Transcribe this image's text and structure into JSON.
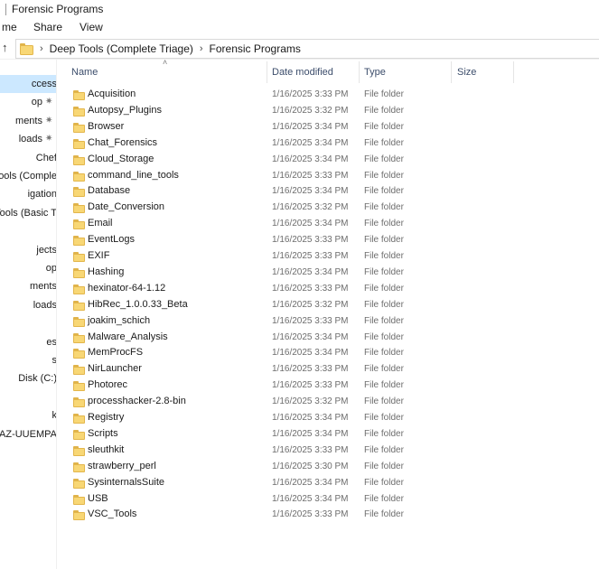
{
  "window": {
    "title": "Forensic Programs"
  },
  "ribbon": {
    "tabs": [
      "me",
      "Share",
      "View"
    ]
  },
  "address": {
    "crumbs": [
      "Deep Tools (Complete Triage)",
      "Forensic Programs"
    ]
  },
  "nav": {
    "items": [
      {
        "label": "ccess",
        "pinned": false,
        "selected": true
      },
      {
        "label": "op",
        "pinned": true,
        "selected": false
      },
      {
        "label": "ments",
        "pinned": true,
        "selected": false
      },
      {
        "label": "loads",
        "pinned": true,
        "selected": false
      },
      {
        "label": "Chef",
        "pinned": false,
        "selected": false
      },
      {
        "label": "Tools (Comple",
        "pinned": false,
        "selected": false
      },
      {
        "label": "igation",
        "pinned": false,
        "selected": false
      },
      {
        "label": "Tools (Basic T",
        "pinned": false,
        "selected": false
      },
      {
        "label": "",
        "pinned": false,
        "selected": false
      },
      {
        "label": "jects",
        "pinned": false,
        "selected": false
      },
      {
        "label": "op",
        "pinned": false,
        "selected": false
      },
      {
        "label": "ments",
        "pinned": false,
        "selected": false
      },
      {
        "label": "loads",
        "pinned": false,
        "selected": false
      },
      {
        "label": "",
        "pinned": false,
        "selected": false
      },
      {
        "label": "es",
        "pinned": false,
        "selected": false
      },
      {
        "label": "s",
        "pinned": false,
        "selected": false
      },
      {
        "label": "Disk (C:)",
        "pinned": false,
        "selected": false
      },
      {
        "label": "",
        "pinned": false,
        "selected": false
      },
      {
        "label": "k",
        "pinned": false,
        "selected": false
      },
      {
        "label": "MAZ-UUEMPA",
        "pinned": false,
        "selected": false
      }
    ]
  },
  "columns": {
    "name": "Name",
    "date": "Date modified",
    "type": "Type",
    "size": "Size"
  },
  "files": [
    {
      "name": "Acquisition",
      "date": "1/16/2025 3:33 PM",
      "type": "File folder"
    },
    {
      "name": "Autopsy_Plugins",
      "date": "1/16/2025 3:32 PM",
      "type": "File folder"
    },
    {
      "name": "Browser",
      "date": "1/16/2025 3:34 PM",
      "type": "File folder"
    },
    {
      "name": "Chat_Forensics",
      "date": "1/16/2025 3:34 PM",
      "type": "File folder"
    },
    {
      "name": "Cloud_Storage",
      "date": "1/16/2025 3:34 PM",
      "type": "File folder"
    },
    {
      "name": "command_line_tools",
      "date": "1/16/2025 3:33 PM",
      "type": "File folder"
    },
    {
      "name": "Database",
      "date": "1/16/2025 3:34 PM",
      "type": "File folder"
    },
    {
      "name": "Date_Conversion",
      "date": "1/16/2025 3:32 PM",
      "type": "File folder"
    },
    {
      "name": "Email",
      "date": "1/16/2025 3:34 PM",
      "type": "File folder"
    },
    {
      "name": "EventLogs",
      "date": "1/16/2025 3:33 PM",
      "type": "File folder"
    },
    {
      "name": "EXIF",
      "date": "1/16/2025 3:33 PM",
      "type": "File folder"
    },
    {
      "name": "Hashing",
      "date": "1/16/2025 3:34 PM",
      "type": "File folder"
    },
    {
      "name": "hexinator-64-1.12",
      "date": "1/16/2025 3:33 PM",
      "type": "File folder"
    },
    {
      "name": "HibRec_1.0.0.33_Beta",
      "date": "1/16/2025 3:32 PM",
      "type": "File folder"
    },
    {
      "name": "joakim_schich",
      "date": "1/16/2025 3:33 PM",
      "type": "File folder"
    },
    {
      "name": "Malware_Analysis",
      "date": "1/16/2025 3:34 PM",
      "type": "File folder"
    },
    {
      "name": "MemProcFS",
      "date": "1/16/2025 3:34 PM",
      "type": "File folder"
    },
    {
      "name": "NirLauncher",
      "date": "1/16/2025 3:33 PM",
      "type": "File folder"
    },
    {
      "name": "Photorec",
      "date": "1/16/2025 3:33 PM",
      "type": "File folder"
    },
    {
      "name": "processhacker-2.8-bin",
      "date": "1/16/2025 3:32 PM",
      "type": "File folder"
    },
    {
      "name": "Registry",
      "date": "1/16/2025 3:34 PM",
      "type": "File folder"
    },
    {
      "name": "Scripts",
      "date": "1/16/2025 3:34 PM",
      "type": "File folder"
    },
    {
      "name": "sleuthkit",
      "date": "1/16/2025 3:33 PM",
      "type": "File folder"
    },
    {
      "name": "strawberry_perl",
      "date": "1/16/2025 3:30 PM",
      "type": "File folder"
    },
    {
      "name": "SysinternalsSuite",
      "date": "1/16/2025 3:34 PM",
      "type": "File folder"
    },
    {
      "name": "USB",
      "date": "1/16/2025 3:34 PM",
      "type": "File folder"
    },
    {
      "name": "VSC_Tools",
      "date": "1/16/2025 3:33 PM",
      "type": "File folder"
    }
  ]
}
